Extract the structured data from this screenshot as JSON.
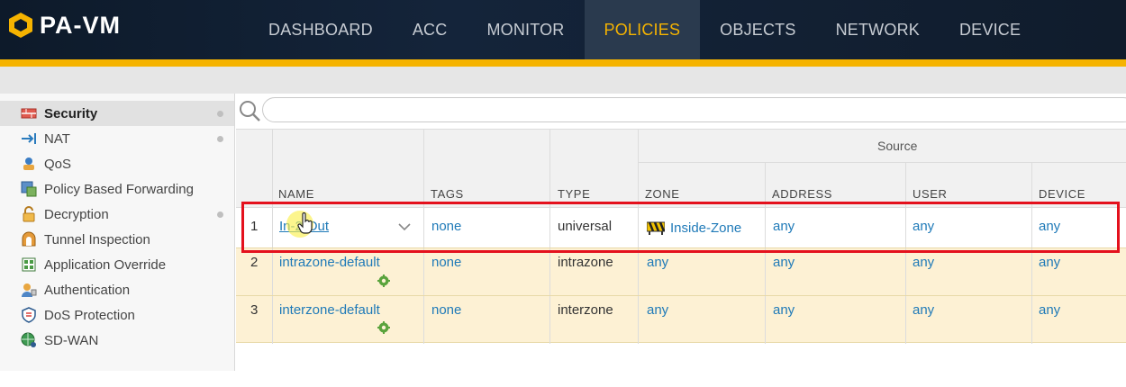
{
  "app": {
    "title": "PA-VM"
  },
  "nav": {
    "items": [
      {
        "label": "DASHBOARD",
        "active": false
      },
      {
        "label": "ACC",
        "active": false
      },
      {
        "label": "MONITOR",
        "active": false
      },
      {
        "label": "POLICIES",
        "active": true
      },
      {
        "label": "OBJECTS",
        "active": false
      },
      {
        "label": "NETWORK",
        "active": false
      },
      {
        "label": "DEVICE",
        "active": false
      }
    ]
  },
  "sidebar": {
    "items": [
      {
        "label": "Security",
        "icon": "security-rule-icon",
        "active": true,
        "dot": true
      },
      {
        "label": "NAT",
        "icon": "nat-icon",
        "dot": true
      },
      {
        "label": "QoS",
        "icon": "qos-icon"
      },
      {
        "label": "Policy Based Forwarding",
        "icon": "pbf-icon"
      },
      {
        "label": "Decryption",
        "icon": "lock-icon",
        "dot": true
      },
      {
        "label": "Tunnel Inspection",
        "icon": "tunnel-icon"
      },
      {
        "label": "Application Override",
        "icon": "app-override-icon"
      },
      {
        "label": "Authentication",
        "icon": "authentication-icon"
      },
      {
        "label": "DoS Protection",
        "icon": "dos-shield-icon"
      },
      {
        "label": "SD-WAN",
        "icon": "sdwan-globe-icon"
      }
    ]
  },
  "search": {
    "placeholder": "",
    "value": ""
  },
  "table": {
    "group_header": "Source",
    "columns": [
      "NAME",
      "TAGS",
      "TYPE",
      "ZONE",
      "ADDRESS",
      "USER",
      "DEVICE"
    ],
    "rows": [
      {
        "index": "1",
        "name": "In-2-Out",
        "tags": "none",
        "type": "universal",
        "zone": "Inside-Zone",
        "address": "any",
        "user": "any",
        "device": "any"
      },
      {
        "index": "2",
        "name": "intrazone-default",
        "tags": "none",
        "type": "intrazone",
        "zone": "any",
        "address": "any",
        "user": "any",
        "device": "any"
      },
      {
        "index": "3",
        "name": "interzone-default",
        "tags": "none",
        "type": "interzone",
        "zone": "any",
        "address": "any",
        "user": "any",
        "device": "any"
      }
    ]
  },
  "colors": {
    "accent": "#f5b300",
    "link": "#1f7ab8",
    "highlight": "#e4111d",
    "default_row": "#fdf1d4"
  }
}
